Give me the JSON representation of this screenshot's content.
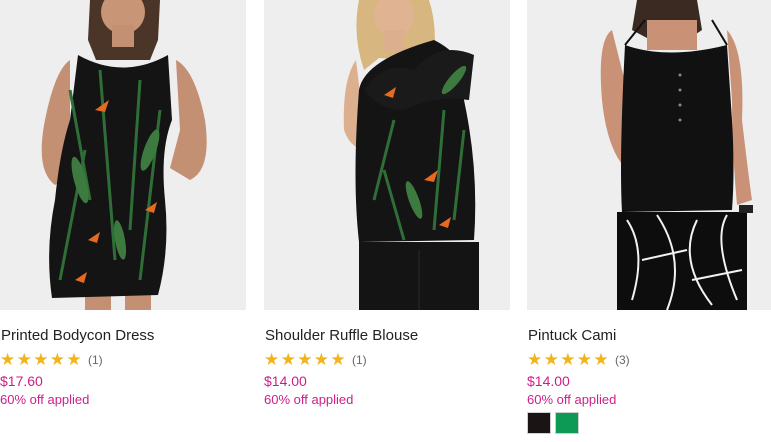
{
  "products": [
    {
      "name": "Printed Bodycon Dress",
      "rating_count": "(1)",
      "price": "$17.60",
      "promo": "60% off applied",
      "rating": 5
    },
    {
      "name": "Shoulder Ruffle Blouse",
      "rating_count": "(1)",
      "price": "$14.00",
      "promo": "60% off applied",
      "rating": 5
    },
    {
      "name": "Pintuck Cami",
      "rating_count": "(3)",
      "price": "$14.00",
      "promo": "60% off applied",
      "rating": 5,
      "swatches": [
        {
          "color": "#1a1414"
        },
        {
          "color": "#0c9a55"
        }
      ]
    }
  ],
  "colors": {
    "star": "#f2b418",
    "price": "#cc1f8a",
    "photo_background": "#eeeeee"
  }
}
